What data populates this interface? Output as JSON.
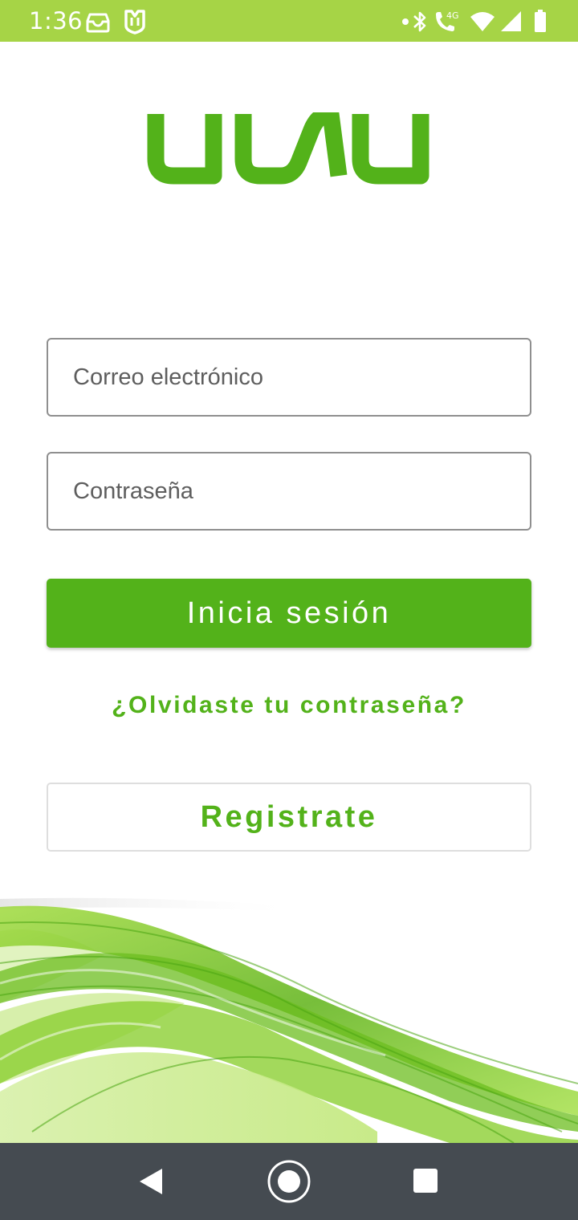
{
  "status_bar": {
    "time": "1:36",
    "left_icons": [
      "message-icon",
      "shield-app-icon"
    ],
    "right_icons": [
      "dot-icon",
      "bluetooth-icon",
      "call-4g-icon",
      "wifi-icon",
      "cell-signal-icon",
      "battery-icon"
    ],
    "network_label": "4G",
    "background": "#a6d446"
  },
  "logo": {
    "text": "uwu",
    "color": "#53b21a"
  },
  "login_form": {
    "email_placeholder": "Correo electrónico",
    "email_value": "",
    "password_placeholder": "Contraseña",
    "password_value": "",
    "login_label": "Inicia sesión",
    "forgot_label": "¿Olvidaste tu contraseña?",
    "register_label": "Registrate"
  },
  "colors": {
    "accent": "#53b21a",
    "status_bar": "#a6d446",
    "nav_bar": "#454b51"
  },
  "nav_bar": {
    "buttons": [
      "back-icon",
      "home-icon",
      "recents-icon"
    ]
  }
}
